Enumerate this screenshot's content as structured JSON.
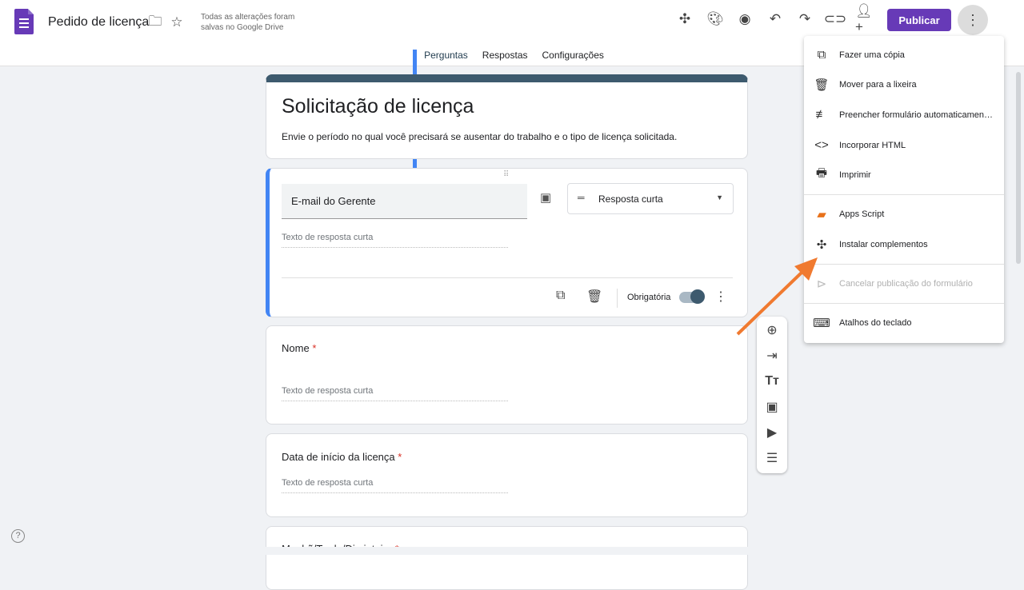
{
  "header": {
    "doc_title": "Pedido de licença",
    "save_status_line1": "Todas as alterações foram",
    "save_status_line2": "salvas no Google Drive",
    "publish_label": "Publicar"
  },
  "tabs": [
    {
      "label": "Perguntas",
      "active": true
    },
    {
      "label": "Respostas"
    },
    {
      "label": "Configurações"
    }
  ],
  "form": {
    "title": "Solicitação de licença",
    "description": "Envie o período no qual você precisará se ausentar do trabalho e o tipo de licença solicitada.",
    "active_question": {
      "title": "E-mail do Gerente",
      "type": "Resposta curta",
      "placeholder": "Texto de resposta curta",
      "required_label": "Obrigatória",
      "required": true
    },
    "questions": [
      {
        "title": "Nome",
        "required_mark": "*",
        "placeholder": "Texto de resposta curta"
      },
      {
        "title": "Data de início da licença",
        "required_mark": "*",
        "placeholder": "Texto de resposta curta"
      },
      {
        "title": "Manhã/Tarde/Dia inteiro",
        "required_mark": "*"
      }
    ]
  },
  "menu": {
    "items": [
      {
        "label": "Fazer uma cópia",
        "icon": "copy-icon"
      },
      {
        "label": "Mover para a lixeira",
        "icon": "trash-icon"
      },
      {
        "label": "Preencher formulário automaticamen…",
        "icon": "autofill-icon"
      },
      {
        "label": "Incorporar HTML",
        "icon": "code-icon"
      },
      {
        "label": "Imprimir",
        "icon": "print-icon"
      },
      {
        "label": "Apps Script",
        "icon": "apps-script-icon"
      },
      {
        "label": "Instalar complementos",
        "icon": "addon-icon"
      },
      {
        "label": "Cancelar publicação do formulário",
        "icon": "unpublish-icon",
        "disabled": true
      },
      {
        "label": "Atalhos do teclado",
        "icon": "keyboard-icon"
      }
    ]
  },
  "colors": {
    "accent": "#673ab7",
    "theme": "#3d5a6e",
    "annotation_arrow": "#f07a30"
  }
}
